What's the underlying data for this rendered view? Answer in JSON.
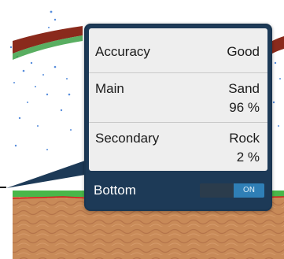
{
  "popup": {
    "rows": [
      {
        "label": "Accuracy",
        "value": "Good",
        "value2": ""
      },
      {
        "label": "Main",
        "value": "Sand",
        "value2": "96 %"
      },
      {
        "label": "Secondary",
        "value": "Rock",
        "value2": "2 %"
      }
    ],
    "footer": {
      "label": "Bottom",
      "toggle_state": "ON"
    }
  },
  "colors": {
    "popup_bg": "#1d3a57",
    "panel_bg": "#eeeeee",
    "toggle_on": "#2f7fb6",
    "seabed": "#c88a58",
    "grass": "#49b749",
    "bottom_line": "#d21e1e"
  }
}
